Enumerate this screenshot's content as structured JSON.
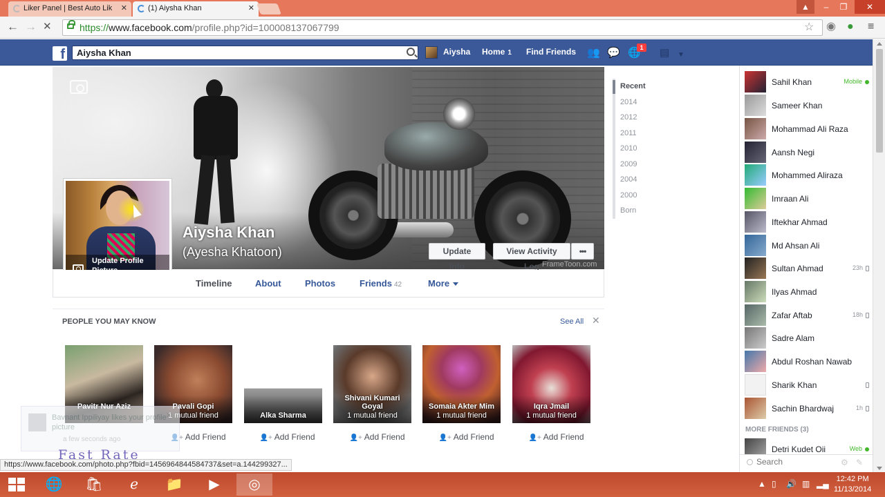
{
  "browser": {
    "tabs": [
      {
        "title": "Liker Panel | Best Auto Lik"
      },
      {
        "title": "(1) Aiyshа Khan"
      }
    ],
    "url": {
      "scheme": "https://",
      "host": "www.facebook.com",
      "path": "/profile.php?id=100008137067799"
    },
    "status_url": "https://www.facebook.com/photo.php?fbid=1456964844584737&set=a.144299327..."
  },
  "fb_header": {
    "search_value": "Aiysha Khan",
    "user_name": "Aiysha",
    "home_label": "Home",
    "home_count": "1",
    "find_friends": "Find Friends",
    "notif_count": "1"
  },
  "profile": {
    "name": "Aiysha Khan",
    "alt_name": "(Ayesha Khatoon)",
    "update_info": "Update Info",
    "view_activity": "View Activity Log",
    "more_dots": "•••",
    "update_picture": "Update Profile Picture",
    "watermark": "FrameToon.com",
    "tabs": {
      "timeline": "Timeline",
      "about": "About",
      "photos": "Photos",
      "friends": "Friends",
      "friends_count": "42",
      "more": "More"
    }
  },
  "pymk": {
    "title": "PEOPLE YOU MAY KNOW",
    "see_all": "See All",
    "people": [
      {
        "name": "Pavitr Nur Aziz",
        "mutual": "",
        "add": "Add Friend"
      },
      {
        "name": "Pavali Gopi",
        "mutual": "1 mutual friend",
        "add": "Add Friend"
      },
      {
        "name": "Alka Sharma",
        "mutual": "",
        "add": "Add Friend"
      },
      {
        "name": "Shivani Kumari Goyal",
        "mutual": "1 mutual friend",
        "add": "Add Friend"
      },
      {
        "name": "Somaia Akter Mim",
        "mutual": "1 mutual friend",
        "add": "Add Friend"
      },
      {
        "name": "Iqra Jmail",
        "mutual": "1 mutual friend",
        "add": "Add Friend"
      }
    ]
  },
  "toast": {
    "text": "Bavnant Ippiliyay likes your profile picture",
    "time": "a few seconds ago"
  },
  "overlay_brand": "Fast Rate",
  "timeline_years": [
    "Recent",
    "2014",
    "2012",
    "2011",
    "2010",
    "2009",
    "2004",
    "2000",
    "Born"
  ],
  "chat": {
    "friends": [
      {
        "name": "Sahil Khan",
        "status": "Mobile",
        "online": true
      },
      {
        "name": "Sameer Khan",
        "status": ""
      },
      {
        "name": "Mohammad Ali Raza",
        "status": ""
      },
      {
        "name": "Aansh Negi",
        "status": ""
      },
      {
        "name": "Mohammed Aliraza",
        "status": ""
      },
      {
        "name": "Imraan Ali",
        "status": ""
      },
      {
        "name": "Iftekhar Ahmad",
        "status": ""
      },
      {
        "name": "Md Ahsan Ali",
        "status": ""
      },
      {
        "name": "Sultan Ahmad",
        "status": "23h"
      },
      {
        "name": "Ilyas Ahmad",
        "status": ""
      },
      {
        "name": "Zafar Aftab",
        "status": "18h"
      },
      {
        "name": "Sadre Alam",
        "status": ""
      },
      {
        "name": "Abdul Roshan Nawab",
        "status": ""
      },
      {
        "name": "Sharik Khan",
        "status": ""
      },
      {
        "name": "Sachin Bhardwaj",
        "status": "1h"
      }
    ],
    "more_friends_label": "MORE FRIENDS (3)",
    "more_friends": [
      {
        "name": "Detri Kudet Oii",
        "status": "Web",
        "online": true
      }
    ],
    "search_placeholder": "Search"
  },
  "taskbar": {
    "time": "12:42 PM",
    "date": "11/13/2014"
  }
}
